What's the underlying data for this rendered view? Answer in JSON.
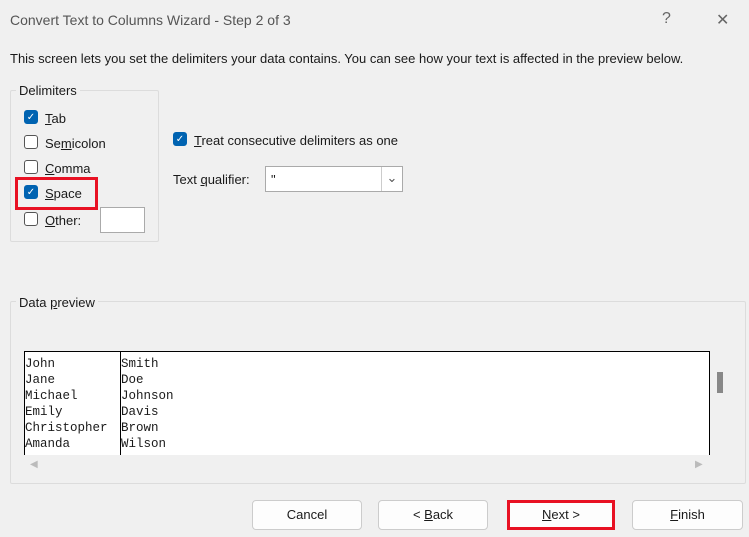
{
  "window": {
    "title": "Convert Text to Columns Wizard - Step 2 of 3",
    "help": "?",
    "close": "✕"
  },
  "description": "This screen lets you set the delimiters your data contains.  You can see how your text is affected in the preview below.",
  "delimiters": {
    "label": "Delimiters",
    "items": [
      {
        "pre": "",
        "u": "T",
        "post": "ab",
        "checked": true
      },
      {
        "pre": "Se",
        "u": "m",
        "post": "icolon",
        "checked": false
      },
      {
        "pre": "",
        "u": "C",
        "post": "omma",
        "checked": false
      },
      {
        "pre": "",
        "u": "S",
        "post": "pace",
        "checked": true
      },
      {
        "pre": "",
        "u": "O",
        "post": "ther:",
        "checked": false
      }
    ],
    "other_value": ""
  },
  "consecutive": {
    "pre": "",
    "u": "T",
    "post": "reat consecutive delimiters as one",
    "checked": true
  },
  "qualifier": {
    "pre": "Text ",
    "u": "q",
    "post": "ualifier:",
    "value": "\""
  },
  "preview": {
    "label_pre": "Data ",
    "label_u": "p",
    "label_post": "review",
    "rows": [
      [
        "John",
        "Smith"
      ],
      [
        "Jane",
        "Doe"
      ],
      [
        "Michael",
        "Johnson"
      ],
      [
        "Emily",
        "Davis"
      ],
      [
        "Christopher",
        "Brown"
      ],
      [
        "Amanda",
        "Wilson"
      ]
    ]
  },
  "buttons": {
    "cancel": "Cancel",
    "back_pre": "< ",
    "back_u": "B",
    "back_post": "ack",
    "next_u": "N",
    "next_post": "ext >",
    "finish_u": "F",
    "finish_post": "inish"
  },
  "highlight_color": "#e81123",
  "accent": "#0063b1"
}
